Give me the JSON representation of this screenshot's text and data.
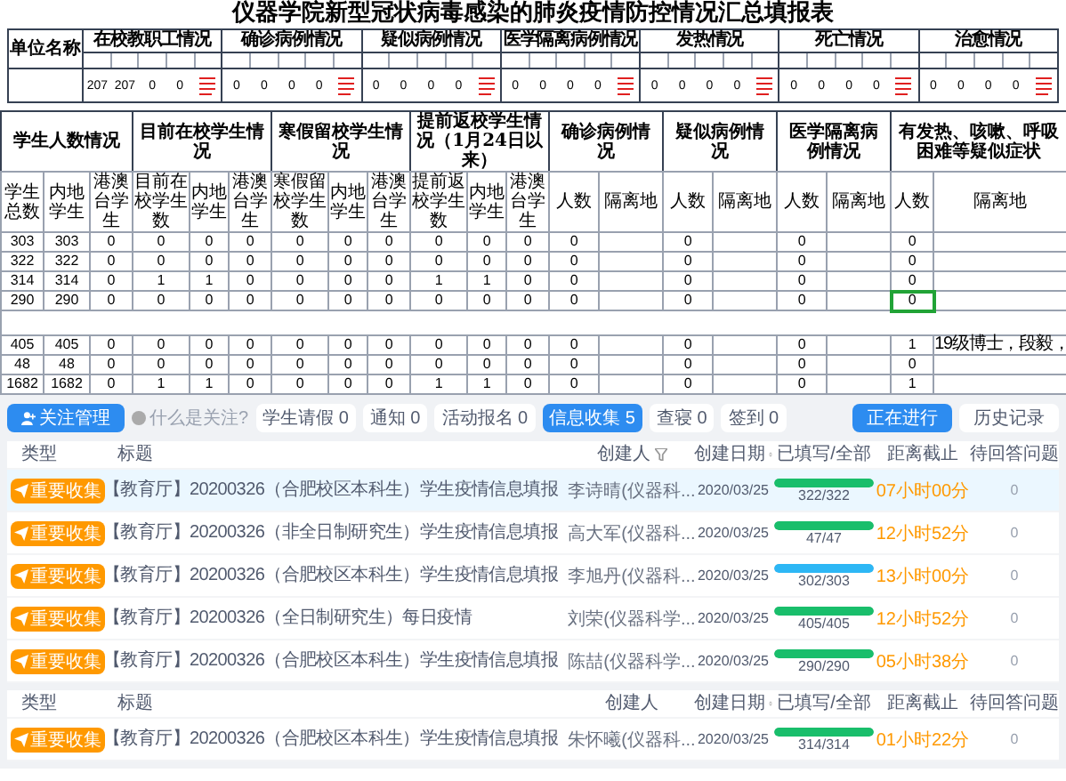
{
  "summary_table": {
    "title": "仪器学院新型冠状病毒感染的肺炎疫情防控情况汇总填报表",
    "name_header": "单位名称",
    "groups": [
      {
        "heading": "在校教职工情况",
        "values": [
          "207",
          "207",
          "0",
          "0"
        ]
      },
      {
        "heading": "确诊病例情况",
        "values": [
          "0",
          "0",
          "0",
          "0"
        ]
      },
      {
        "heading": "疑似病例情况",
        "values": [
          "0",
          "0",
          "0",
          "0"
        ]
      },
      {
        "heading": "医学隔离病例情况",
        "values": [
          "0",
          "0",
          "0",
          "0"
        ]
      },
      {
        "heading": "发热情况",
        "values": [
          "0",
          "0",
          "0",
          "0"
        ]
      },
      {
        "heading": "死亡情况",
        "values": [
          "0",
          "0",
          "0",
          "0"
        ]
      },
      {
        "heading": "治愈情况",
        "values": [
          "0",
          "0",
          "0",
          "0"
        ]
      }
    ]
  },
  "sheet": {
    "groups": [
      {
        "heading": "学生人数情况",
        "columns": [
          "学生总数",
          "内地学生",
          "港澳台学生"
        ]
      },
      {
        "heading": "目前在校学生情况",
        "columns": [
          "目前在校学生数",
          "内地学生",
          "港澳台学生"
        ]
      },
      {
        "heading": "寒假留校学生情况",
        "columns": [
          "寒假留校学生数",
          "内地学生",
          "港澳台学生"
        ]
      },
      {
        "heading": "提前返校学生情况（1月24日以来）",
        "columns": [
          "提前返校学生数",
          "内地学生",
          "港澳台学生"
        ]
      },
      {
        "heading": "确诊病例情况",
        "columns": [
          "人数",
          "隔离地"
        ]
      },
      {
        "heading": "疑似病例情况",
        "columns": [
          "人数",
          "隔离地"
        ]
      },
      {
        "heading": "医学隔离病例情况",
        "columns": [
          "人数",
          "隔离地"
        ]
      },
      {
        "heading": "有发热、咳嗽、呼吸困难等疑似症状",
        "columns": [
          "人数",
          "隔离地"
        ]
      }
    ],
    "rows": [
      {
        "kind": "data",
        "fever_selected": false,
        "cells": [
          "303",
          "303",
          "0",
          "0",
          "0",
          "0",
          "0",
          "0",
          "0",
          "0",
          "0",
          "0",
          "0",
          null,
          "0",
          null,
          "0",
          null,
          "0",
          null
        ]
      },
      {
        "kind": "data",
        "fever_selected": false,
        "cells": [
          "322",
          "322",
          "0",
          "0",
          "0",
          "0",
          "0",
          "0",
          "0",
          "0",
          "0",
          "0",
          "0",
          null,
          "0",
          null,
          "0",
          null,
          "0",
          null
        ]
      },
      {
        "kind": "data",
        "fever_selected": false,
        "cells": [
          "314",
          "314",
          "0",
          "1",
          "1",
          "0",
          "0",
          "0",
          "0",
          "1",
          "1",
          "0",
          "0",
          null,
          "0",
          null,
          "0",
          null,
          "0",
          null
        ]
      },
      {
        "kind": "data",
        "fever_selected": true,
        "cells": [
          "290",
          "290",
          "0",
          "0",
          "0",
          "0",
          "0",
          "0",
          "0",
          "0",
          "0",
          "0",
          "0",
          null,
          "0",
          null,
          "0",
          null,
          "0",
          null
        ]
      },
      {
        "kind": "blank"
      },
      {
        "kind": "data",
        "fever_selected": false,
        "cells": [
          "405",
          "405",
          "0",
          "0",
          "0",
          "0",
          "0",
          "0",
          "0",
          "0",
          "0",
          "0",
          "0",
          null,
          "0",
          null,
          "0",
          null,
          "1",
          "19级博士，段毅，"
        ]
      },
      {
        "kind": "data",
        "fever_selected": false,
        "cells": [
          "48",
          "48",
          "0",
          "0",
          "0",
          "0",
          "0",
          "0",
          "0",
          "0",
          "0",
          "0",
          "0",
          null,
          "0",
          null,
          "0",
          null,
          "0",
          null
        ]
      },
      {
        "kind": "data",
        "fever_selected": false,
        "cells": [
          "1682",
          "1682",
          "0",
          "1",
          "1",
          "0",
          "0",
          "0",
          "0",
          "1",
          "1",
          "0",
          "0",
          null,
          "0",
          null,
          "0",
          null,
          "1",
          null
        ]
      }
    ]
  },
  "toolbar": {
    "follow_button": "关注管理",
    "help_link": "什么是关注?",
    "tabs": [
      {
        "label": "学生请假 0",
        "selected": false
      },
      {
        "label": "通知 0",
        "selected": false
      },
      {
        "label": "活动报名 0",
        "selected": false
      },
      {
        "label": "信息收集 5",
        "selected": true
      },
      {
        "label": "查寝 0",
        "selected": false
      },
      {
        "label": "签到 0",
        "selected": false
      }
    ],
    "views": [
      {
        "label": "正在进行",
        "selected": true
      },
      {
        "label": "历史记录",
        "selected": false
      }
    ]
  },
  "list": {
    "columns": [
      "类型",
      "标题",
      "创建人",
      "创建日期",
      "已填写/全部",
      "距离截止",
      "待回答问题"
    ],
    "rows": [
      {
        "selected": true,
        "badge": "重要收集",
        "title": "【教育厅】20200326（合肥校区本科生）学生疫情信息填报",
        "creator": "李诗晴(仪器科...",
        "date": "2020/03/25",
        "level": 1,
        "color": "#19be6b",
        "reading": "322/322",
        "deadline": "07小时00分",
        "pending": "0"
      },
      {
        "selected": false,
        "badge": "重要收集",
        "title": "【教育厅】20200326（非全日制研究生）学生疫情信息填报",
        "creator": "高大军(仪器科...",
        "date": "2020/03/25",
        "level": 1,
        "color": "#19be6b",
        "reading": "47/47",
        "deadline": "12小时52分",
        "pending": "0"
      },
      {
        "selected": false,
        "badge": "重要收集",
        "title": "【教育厅】20200326（合肥校区本科生）学生疫情信息填报",
        "creator": "李旭丹(仪器科...",
        "date": "2020/03/25",
        "level": 0.997,
        "color": "#2db7f5",
        "reading": "302/303",
        "deadline": "13小时00分",
        "pending": "0"
      },
      {
        "selected": false,
        "badge": "重要收集",
        "title": "【教育厅】20200326（全日制研究生）每日疫情",
        "creator": "刘荣(仪器科学...",
        "date": "2020/03/25",
        "level": 1,
        "color": "#19be6b",
        "reading": "405/405",
        "deadline": "12小时52分",
        "pending": "0"
      },
      {
        "selected": false,
        "badge": "重要收集",
        "title": "【教育厅】20200326（合肥校区本科生）学生疫情信息填报",
        "creator": "陈喆(仪器科学...",
        "date": "2020/03/25",
        "level": 1,
        "color": "#19be6b",
        "reading": "290/290",
        "deadline": "05小时38分",
        "pending": "0"
      }
    ]
  },
  "list2": {
    "columns": [
      "类型",
      "标题",
      "创建人",
      "创建日期",
      "已填写/全部",
      "距离截止",
      "待回答问题"
    ],
    "rows": [
      {
        "selected": false,
        "badge": "重要收集",
        "title": "【教育厅】20200326（合肥校区本科生）学生疫情信息填报",
        "creator": "朱怀曦(仪器科...",
        "date": "2020/03/25",
        "level": 1,
        "color": "#19be6b",
        "reading": "314/314",
        "deadline": "01小时22分",
        "pending": "0"
      }
    ]
  }
}
